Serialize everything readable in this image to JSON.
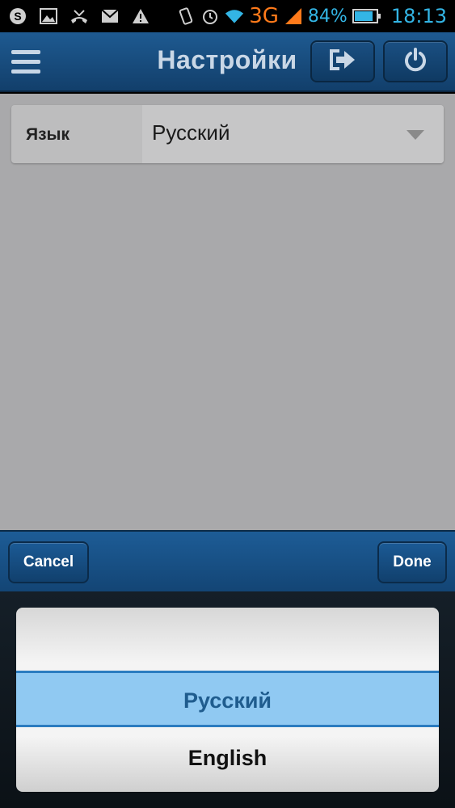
{
  "status_bar": {
    "icons": [
      "skype-icon",
      "image-icon",
      "missed-call-icon",
      "gmail-icon",
      "warning-icon",
      "vibrate-icon",
      "alarm-icon",
      "wifi-icon",
      "signal-icon",
      "battery-icon"
    ],
    "network": "3G",
    "battery_percent": "84%",
    "time": "18:13"
  },
  "header": {
    "title": "Настройки"
  },
  "settings": {
    "language_label": "Язык",
    "language_value": "Русский"
  },
  "picker": {
    "cancel_label": "Cancel",
    "done_label": "Done",
    "options": [
      "Русский",
      "English"
    ],
    "selected": "Русский"
  },
  "colors": {
    "header_blue": "#1e5a91",
    "selection_blue": "#90c9f2",
    "status_accent": "#33b5e5",
    "network_orange": "#ff7a1a"
  }
}
